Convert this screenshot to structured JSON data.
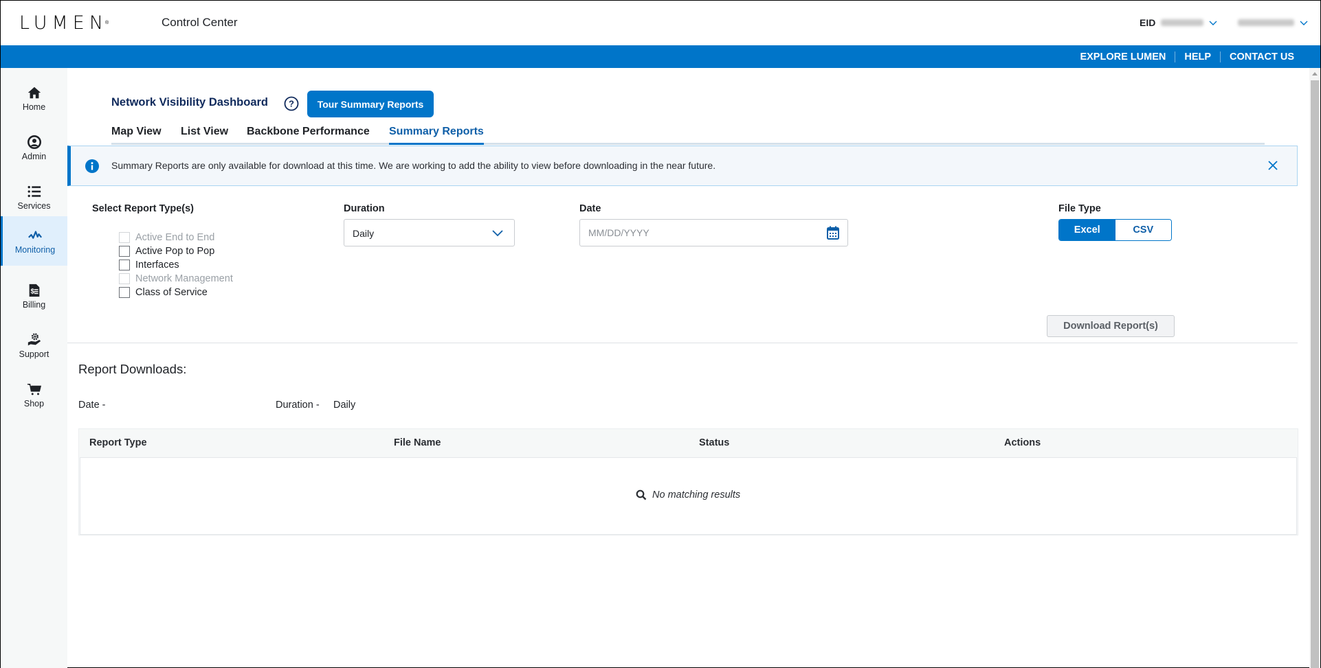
{
  "header": {
    "logo": "LUMEN",
    "app_title": "Control Center",
    "eid_label": "EID",
    "util_links": [
      "EXPLORE LUMEN",
      "HELP",
      "CONTACT US"
    ]
  },
  "colors": {
    "brand_blue": "#0075c9",
    "active_tab": "#0f5fa8",
    "title_navy": "#102a5c"
  },
  "sidebar": {
    "items": [
      {
        "label": "Home",
        "icon": "home-icon"
      },
      {
        "label": "Admin",
        "icon": "user-circle-icon"
      },
      {
        "label": "Services",
        "icon": "list-icon"
      },
      {
        "label": "Monitoring",
        "icon": "pulse-icon",
        "active": true
      },
      {
        "label": "Billing",
        "icon": "invoice-icon"
      },
      {
        "label": "Support",
        "icon": "support-gear-hand-icon"
      },
      {
        "label": "Shop",
        "icon": "cart-icon"
      }
    ]
  },
  "page": {
    "title": "Network Visibility Dashboard",
    "tour_button": "Tour Summary Reports",
    "tabs": [
      {
        "label": "Map View"
      },
      {
        "label": "List View"
      },
      {
        "label": "Backbone Performance"
      },
      {
        "label": "Summary Reports",
        "active": true
      }
    ]
  },
  "alert": {
    "text": "Summary Reports are only available for download at this time. We are working to add the ability to view before downloading in the near future."
  },
  "form": {
    "report_types_label": "Select Report Type(s)",
    "report_types": [
      {
        "label": "Active End to End",
        "disabled": true,
        "checked": false
      },
      {
        "label": "Active Pop to Pop",
        "disabled": false,
        "checked": false
      },
      {
        "label": "Interfaces",
        "disabled": false,
        "checked": false
      },
      {
        "label": "Network Management",
        "disabled": true,
        "checked": false
      },
      {
        "label": "Class of Service",
        "disabled": false,
        "checked": false
      }
    ],
    "duration_label": "Duration",
    "duration_value": "Daily",
    "date_label": "Date",
    "date_placeholder": "MM/DD/YYYY",
    "file_type_label": "File Type",
    "file_types": [
      {
        "label": "Excel",
        "active": true
      },
      {
        "label": "CSV",
        "active": false
      }
    ],
    "download_button": "Download Report(s)"
  },
  "downloads": {
    "title": "Report Downloads:",
    "date_label": "Date -",
    "date_value": "",
    "duration_label": "Duration -",
    "duration_value": "Daily",
    "columns": [
      "Report Type",
      "File Name",
      "Status",
      "Actions"
    ],
    "rows": [],
    "empty_text": "No matching results"
  }
}
